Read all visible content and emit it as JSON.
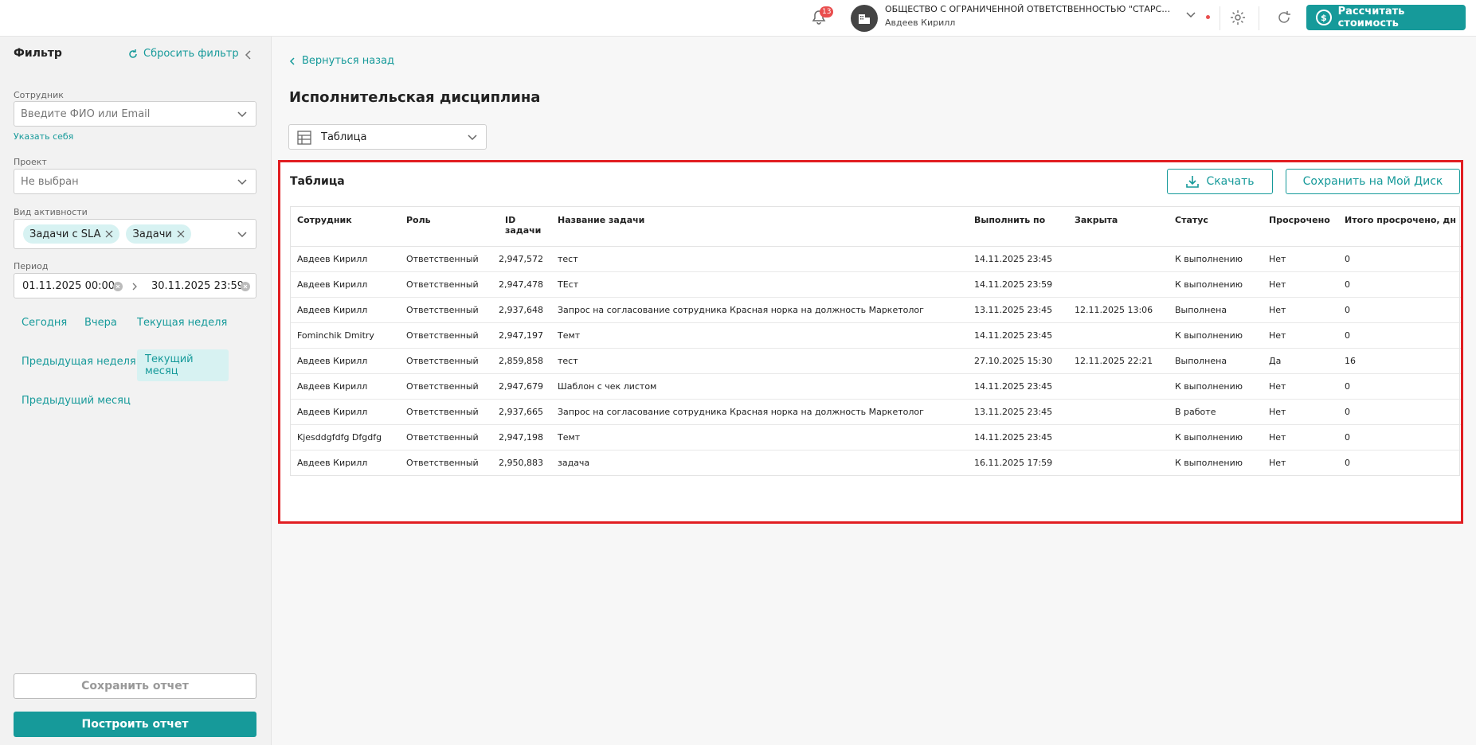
{
  "topbar": {
    "notifications_count": "13",
    "company_name": "ОБЩЕСТВО С ОГРАНИЧЕННОЙ ОТВЕТСТВЕННОСТЬЮ \"СТАРСАВТО\"...",
    "user_name": "Авдеев Кирилл",
    "calc_button": "Рассчитать стоимость",
    "accent_color": "#169a9a",
    "badge_color": "#e94e4e"
  },
  "sidebar": {
    "title": "Фильтр",
    "reset_label": "Сбросить фильтр",
    "employee": {
      "label": "Сотрудник",
      "placeholder": "Введите ФИО или Email",
      "self_link": "Указать себя"
    },
    "project": {
      "label": "Проект",
      "value": "Не выбран"
    },
    "activity": {
      "label": "Вид активности",
      "tags": [
        "Задачи с SLA",
        "Задачи"
      ]
    },
    "period": {
      "label": "Период",
      "from": "01.11.2025 00:00",
      "to": "30.11.2025 23:59",
      "presets": [
        "Сегодня",
        "Вчера",
        "Текущая неделя",
        "Предыдущая неделя",
        "Текущий месяц",
        "Предыдущий месяц"
      ],
      "active_preset": "Текущий месяц"
    },
    "save_report": "Сохранить отчет",
    "build_report": "Построить отчет"
  },
  "main": {
    "back_label": "Вернуться назад",
    "title": "Исполнительская дисциплина",
    "view_select": "Таблица",
    "panel": {
      "title": "Таблица",
      "download_label": "Скачать",
      "save_disk_label": "Сохранить на Мой Диск",
      "columns": [
        "Сотрудник",
        "Роль",
        "ID задачи",
        "Название задачи",
        "Выполнить по",
        "Закрыта",
        "Статус",
        "Просрочено",
        "Итого просрочено, дн"
      ],
      "rows": [
        [
          "Авдеев Кирилл",
          "Ответственный",
          "2,947,572",
          "тест",
          "14.11.2025 23:45",
          "",
          "К выполнению",
          "Нет",
          "0"
        ],
        [
          "Авдеев Кирилл",
          "Ответственный",
          "2,947,478",
          "ТЕст",
          "14.11.2025 23:59",
          "",
          "К выполнению",
          "Нет",
          "0"
        ],
        [
          "Авдеев Кирилл",
          "Ответственный",
          "2,937,648",
          "Запрос на согласование сотрудника Красная норка на должность Маркетолог",
          "13.11.2025 23:45",
          "12.11.2025 13:06",
          "Выполнена",
          "Нет",
          "0"
        ],
        [
          "Fominchik Dmitry",
          "Ответственный",
          "2,947,197",
          "Темт",
          "14.11.2025 23:45",
          "",
          "К выполнению",
          "Нет",
          "0"
        ],
        [
          "Авдеев Кирилл",
          "Ответственный",
          "2,859,858",
          "тест",
          "27.10.2025 15:30",
          "12.11.2025 22:21",
          "Выполнена",
          "Да",
          "16"
        ],
        [
          "Авдеев Кирилл",
          "Ответственный",
          "2,947,679",
          "Шаблон с чек листом",
          "14.11.2025 23:45",
          "",
          "К выполнению",
          "Нет",
          "0"
        ],
        [
          "Авдеев Кирилл",
          "Ответственный",
          "2,937,665",
          "Запрос на согласование сотрудника Красная норка на должность Маркетолог",
          "13.11.2025 23:45",
          "",
          "В работе",
          "Нет",
          "0"
        ],
        [
          "Kjesddgfdfg Dfgdfg",
          "Ответственный",
          "2,947,198",
          "Темт",
          "14.11.2025 23:45",
          "",
          "К выполнению",
          "Нет",
          "0"
        ],
        [
          "Авдеев Кирилл",
          "Ответственный",
          "2,950,883",
          "задача",
          "16.11.2025 17:59",
          "",
          "К выполнению",
          "Нет",
          "0"
        ]
      ]
    }
  }
}
